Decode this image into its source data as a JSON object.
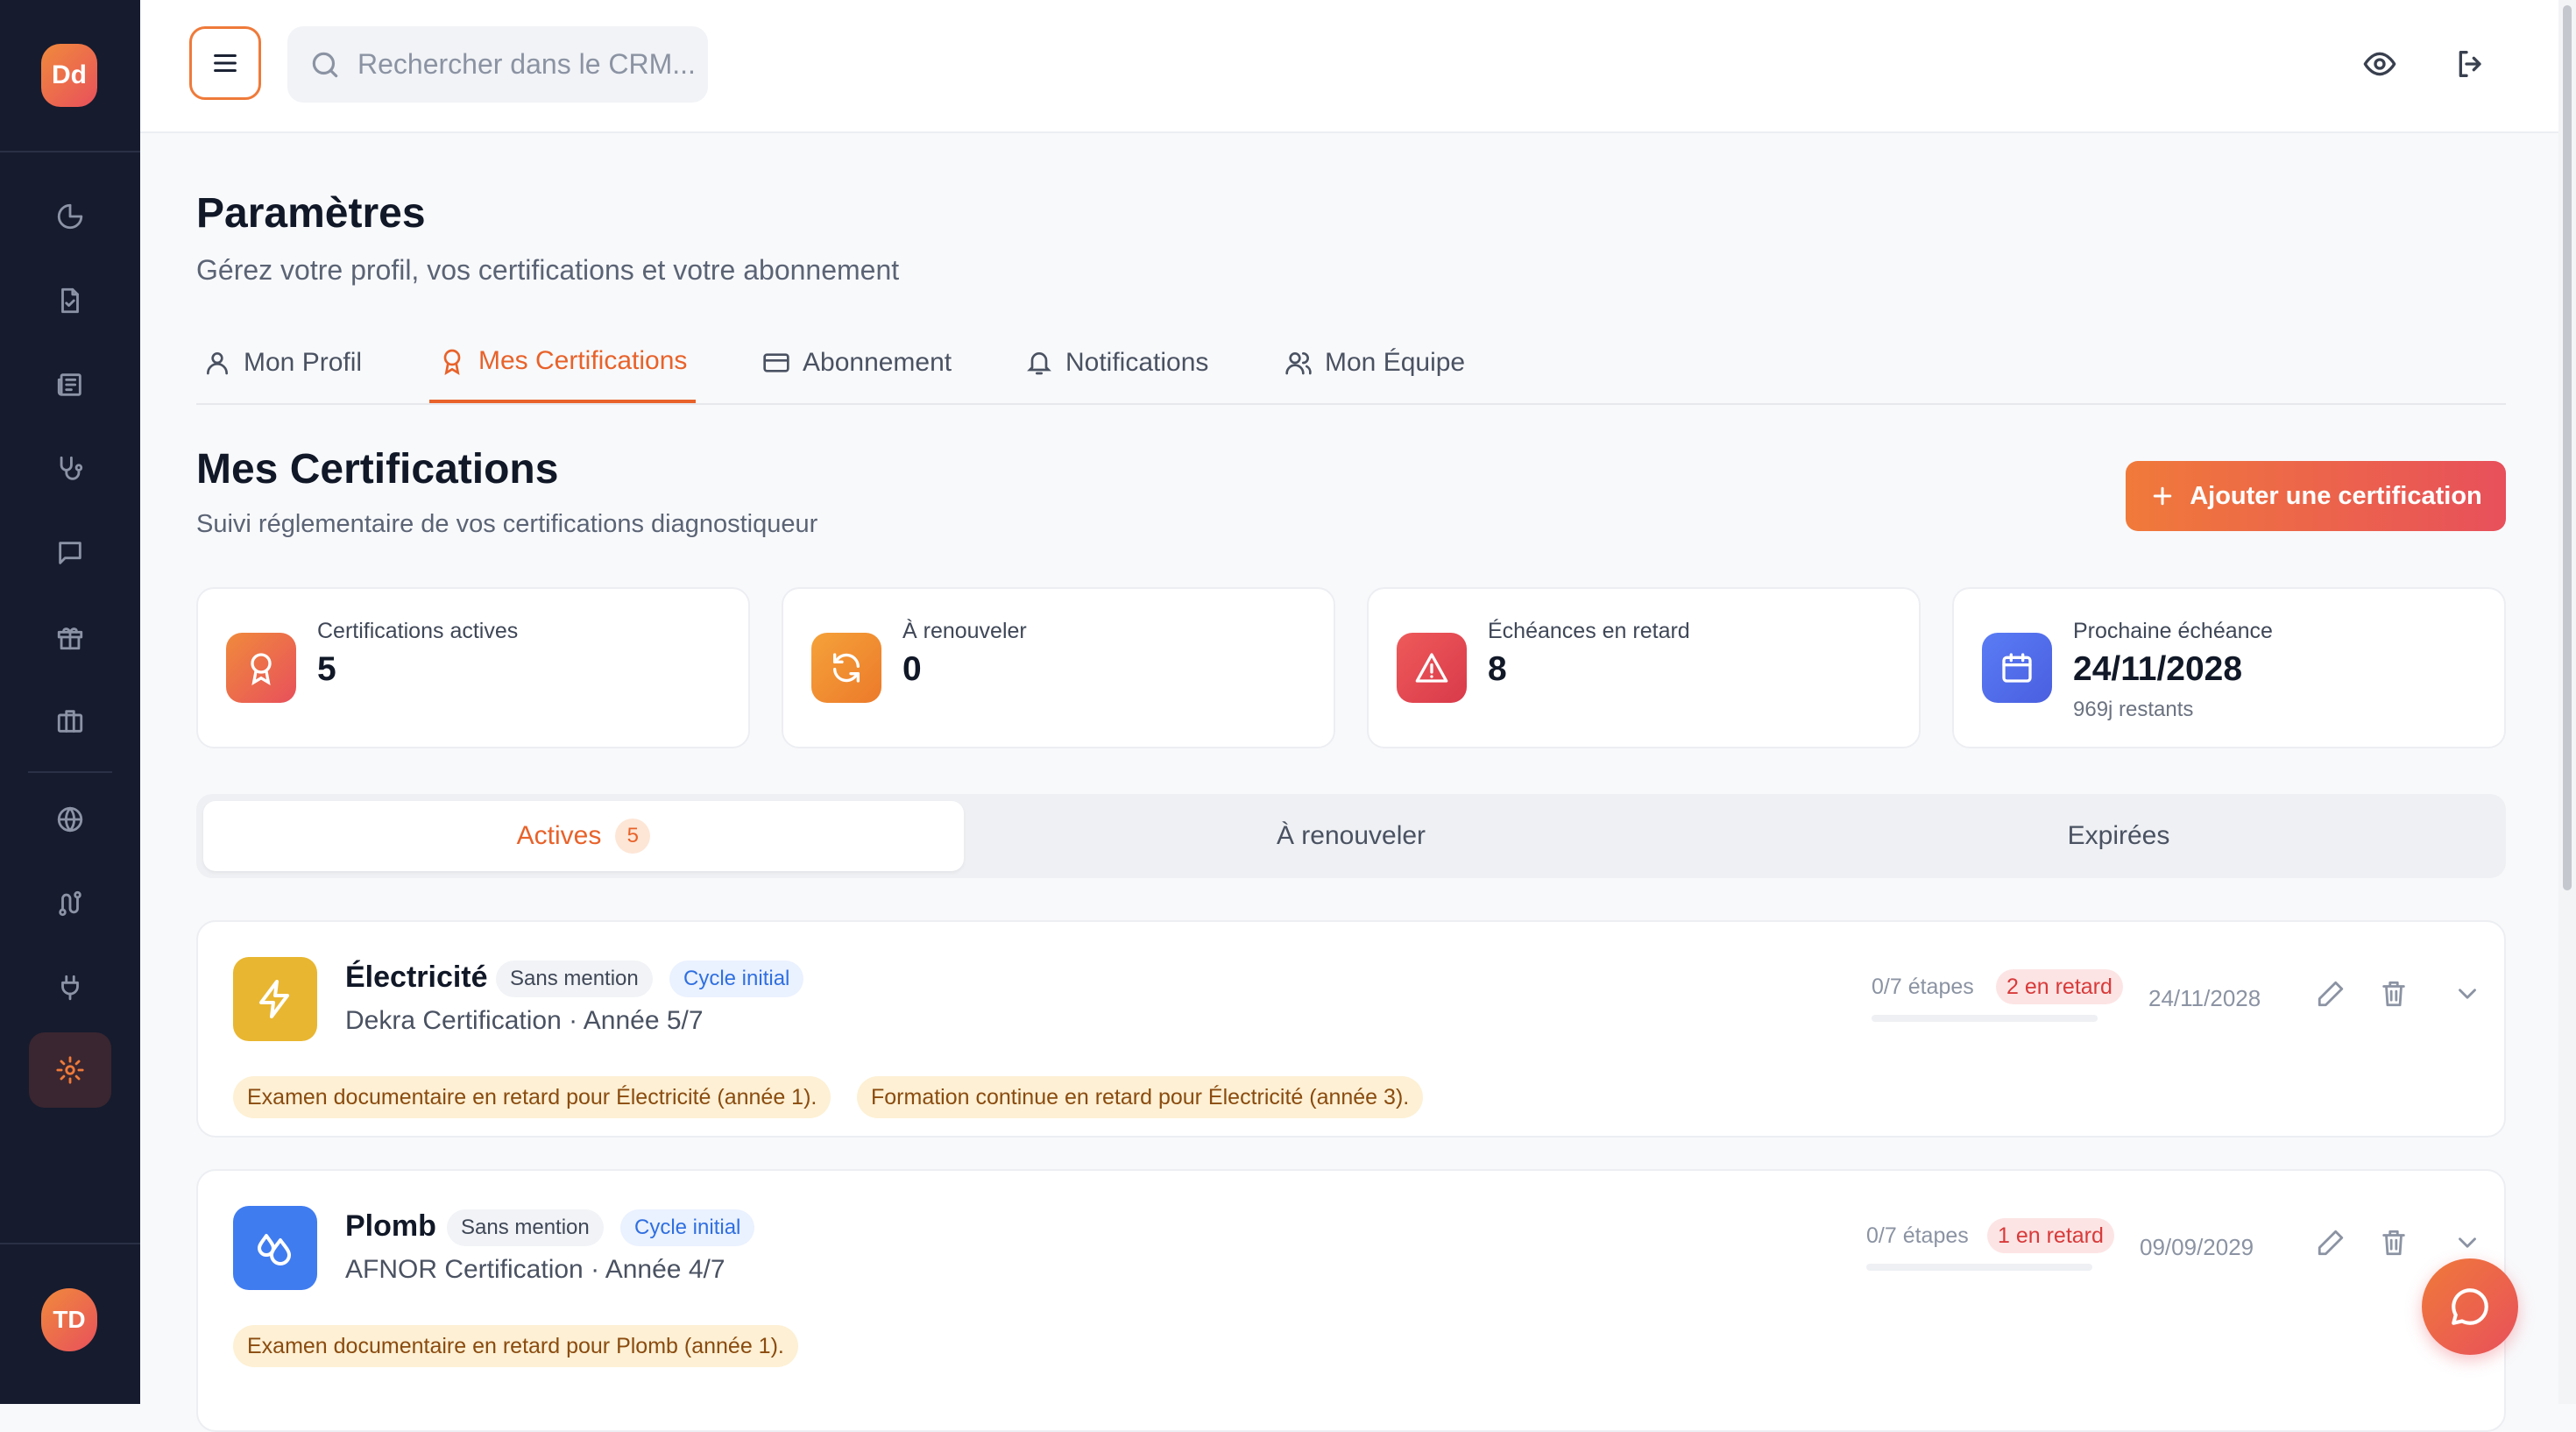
{
  "sidebar": {
    "logo": "Dd",
    "items": [
      {
        "icon": "pie-chart-icon"
      },
      {
        "icon": "file-check-icon"
      },
      {
        "icon": "newspaper-icon"
      },
      {
        "icon": "stethoscope-icon"
      },
      {
        "icon": "message-icon"
      },
      {
        "icon": "gift-icon"
      },
      {
        "icon": "briefcase-icon"
      },
      {
        "icon": "globe-icon"
      },
      {
        "icon": "route-icon"
      },
      {
        "icon": "plug-icon"
      },
      {
        "icon": "settings-icon",
        "active": true
      }
    ],
    "user_initials": "TD"
  },
  "header": {
    "search_placeholder": "Rechercher dans le CRM...",
    "icons": [
      "eye-icon",
      "logout-icon"
    ]
  },
  "page": {
    "title": "Paramètres",
    "subtitle": "Gérez votre profil, vos certifications et votre abonnement"
  },
  "tabs": [
    {
      "label": "Mon Profil",
      "icon": "user-icon"
    },
    {
      "label": "Mes Certifications",
      "icon": "award-icon",
      "active": true
    },
    {
      "label": "Abonnement",
      "icon": "credit-card-icon"
    },
    {
      "label": "Notifications",
      "icon": "bell-icon"
    },
    {
      "label": "Mon Équipe",
      "icon": "users-icon"
    }
  ],
  "section": {
    "title": "Mes Certifications",
    "subtitle": "Suivi réglementaire de vos certifications diagnostiqueur",
    "add_button": "Ajouter une certification"
  },
  "stats": [
    {
      "label": "Certifications actives",
      "value": "5",
      "icon": "award-icon",
      "color": "#ee6b3b"
    },
    {
      "label": "À renouveler",
      "value": "0",
      "icon": "refresh-icon",
      "color": "#f08a2c"
    },
    {
      "label": "Échéances en retard",
      "value": "8",
      "icon": "alert-triangle-icon",
      "color": "#e5484d"
    },
    {
      "label": "Prochaine échéance",
      "value": "24/11/2028",
      "extra": "969j restants",
      "icon": "calendar-icon",
      "color": "#4f6ef0"
    }
  ],
  "filters": {
    "active": {
      "label": "Actives",
      "count": "5"
    },
    "renew": {
      "label": "À renouveler"
    },
    "expired": {
      "label": "Expirées"
    }
  },
  "certifications": [
    {
      "name": "Électricité",
      "mention": "Sans mention",
      "cycle": "Cycle initial",
      "org": "Dekra Certification · Année 5/7",
      "steps": "0/7 étapes",
      "late": "2 en retard",
      "date": "24/11/2028",
      "icon": "zap-icon",
      "color": "#e8b630",
      "progress": 0,
      "warnings": [
        "Examen documentaire en retard pour Électricité (année 1).",
        "Formation continue en retard pour Électricité (année 3)."
      ]
    },
    {
      "name": "Plomb",
      "mention": "Sans mention",
      "cycle": "Cycle initial",
      "org": "AFNOR Certification · Année 4/7",
      "steps": "0/7 étapes",
      "late": "1 en retard",
      "date": "09/09/2029",
      "icon": "droplets-icon",
      "color": "#3f7cf0",
      "progress": 0,
      "warnings": [
        "Examen documentaire en retard pour Plomb (année 1)."
      ]
    }
  ],
  "chat_icon": "chat-bubble-icon"
}
